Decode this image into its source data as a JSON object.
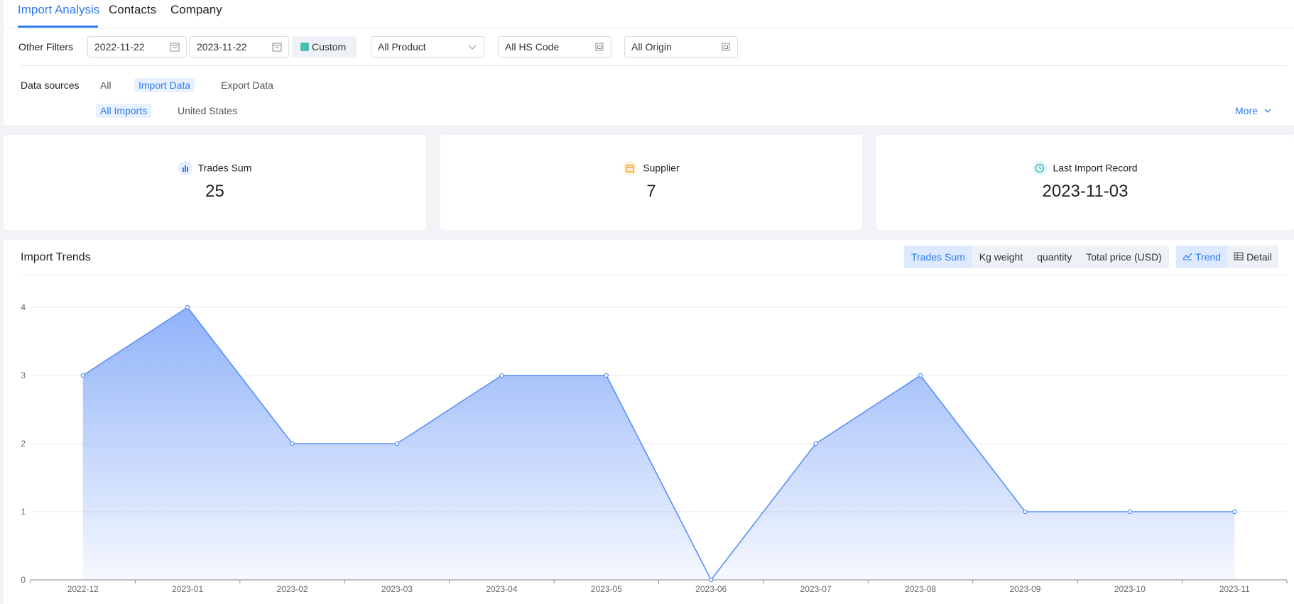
{
  "tabs": [
    "Import Analysis",
    "Contacts",
    "Company"
  ],
  "filters": {
    "label": "Other Filters",
    "date_start": "2022-11-22",
    "date_end": "2023-11-22",
    "custom": "Custom",
    "product": "All Product",
    "hs_code": "All HS Code",
    "origin": "All Origin"
  },
  "sources": {
    "label": "Data sources",
    "options": [
      "All",
      "Import Data",
      "Export Data"
    ],
    "sub_options": [
      "All Imports",
      "United States"
    ],
    "more": "More"
  },
  "stats": [
    {
      "label": "Trades Sum",
      "value": "25"
    },
    {
      "label": "Supplier",
      "value": "7"
    },
    {
      "label": "Last Import Record",
      "value": "2023-11-03"
    }
  ],
  "chart_panel": {
    "title": "Import Trends",
    "metrics": [
      "Trades Sum",
      "Kg weight",
      "quantity",
      "Total price (USD)"
    ],
    "views": [
      "Trend",
      "Detail"
    ]
  },
  "colors": {
    "accent": "#2f7bf0",
    "line": "#5b8ff9",
    "area_top": "#8fb2f9"
  },
  "chart_data": {
    "type": "area",
    "categories": [
      "2022-12",
      "2023-01",
      "2023-02",
      "2023-03",
      "2023-04",
      "2023-05",
      "2023-06",
      "2023-07",
      "2023-08",
      "2023-09",
      "2023-10",
      "2023-11"
    ],
    "values": [
      3,
      4,
      2,
      2,
      3,
      3,
      0,
      2,
      3,
      1,
      1,
      1
    ],
    "yticks": [
      0,
      1,
      2,
      3,
      4
    ],
    "ylim": [
      0,
      4
    ],
    "grid": true
  }
}
